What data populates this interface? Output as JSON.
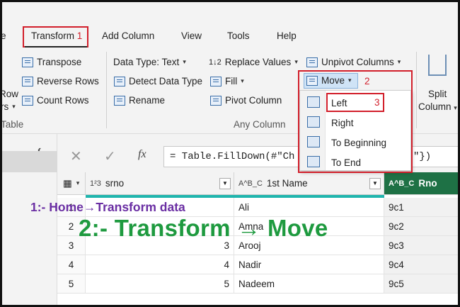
{
  "tabs": {
    "home_partial": "e",
    "transform": "Transform",
    "transform_step": "1",
    "add_column": "Add Column",
    "view": "View",
    "tools": "Tools",
    "help": "Help"
  },
  "ribbon": {
    "row_partial": "Row",
    "rs_partial": "rs",
    "table_partial": "Table",
    "transpose": "Transpose",
    "reverse_rows": "Reverse Rows",
    "count_rows": "Count Rows",
    "data_type": "Data Type: Text",
    "detect_data_type": "Detect Data Type",
    "rename": "Rename",
    "replace_values": "Replace Values",
    "fill": "Fill",
    "pivot_column": "Pivot Column",
    "unpivot_columns": "Unpivot Columns",
    "move": "Move",
    "move_step": "2",
    "any_column": "Any Column",
    "split_column_1": "Split",
    "split_column_2": "Column"
  },
  "move_menu": {
    "left": "Left",
    "left_step": "3",
    "right": "Right",
    "to_beginning": "To Beginning",
    "to_end": "To End"
  },
  "formula_bar": {
    "fx": "fx",
    "text": "= Table.FillDown(#\"Ch",
    "text_end": "\"})"
  },
  "grid": {
    "headers": [
      {
        "type": "1²3",
        "name": "srno"
      },
      {
        "type": "A^B_C",
        "name": "1st Name"
      },
      {
        "type": "A^B_C",
        "name": "Rno"
      }
    ],
    "rows": [
      {
        "n": "1",
        "srno": "",
        "name": "Ali",
        "rno": "9c1"
      },
      {
        "n": "2",
        "srno": "",
        "name": "Amna",
        "rno": "9c2"
      },
      {
        "n": "3",
        "srno": "3",
        "name": "Arooj",
        "rno": "9c3"
      },
      {
        "n": "4",
        "srno": "4",
        "name": "Nadir",
        "rno": "9c4"
      },
      {
        "n": "5",
        "srno": "5",
        "name": "Nadeem",
        "rno": "9c5"
      }
    ]
  },
  "annotations": {
    "line1": "1:- Home→Transform data",
    "line2": "2:- Transform → Move"
  },
  "colors": {
    "red": "#d21f2b",
    "green": "#1e9a3f",
    "purple": "#6a2ea3",
    "teal": "#1fb5ad",
    "rno_header": "#1e7145"
  }
}
